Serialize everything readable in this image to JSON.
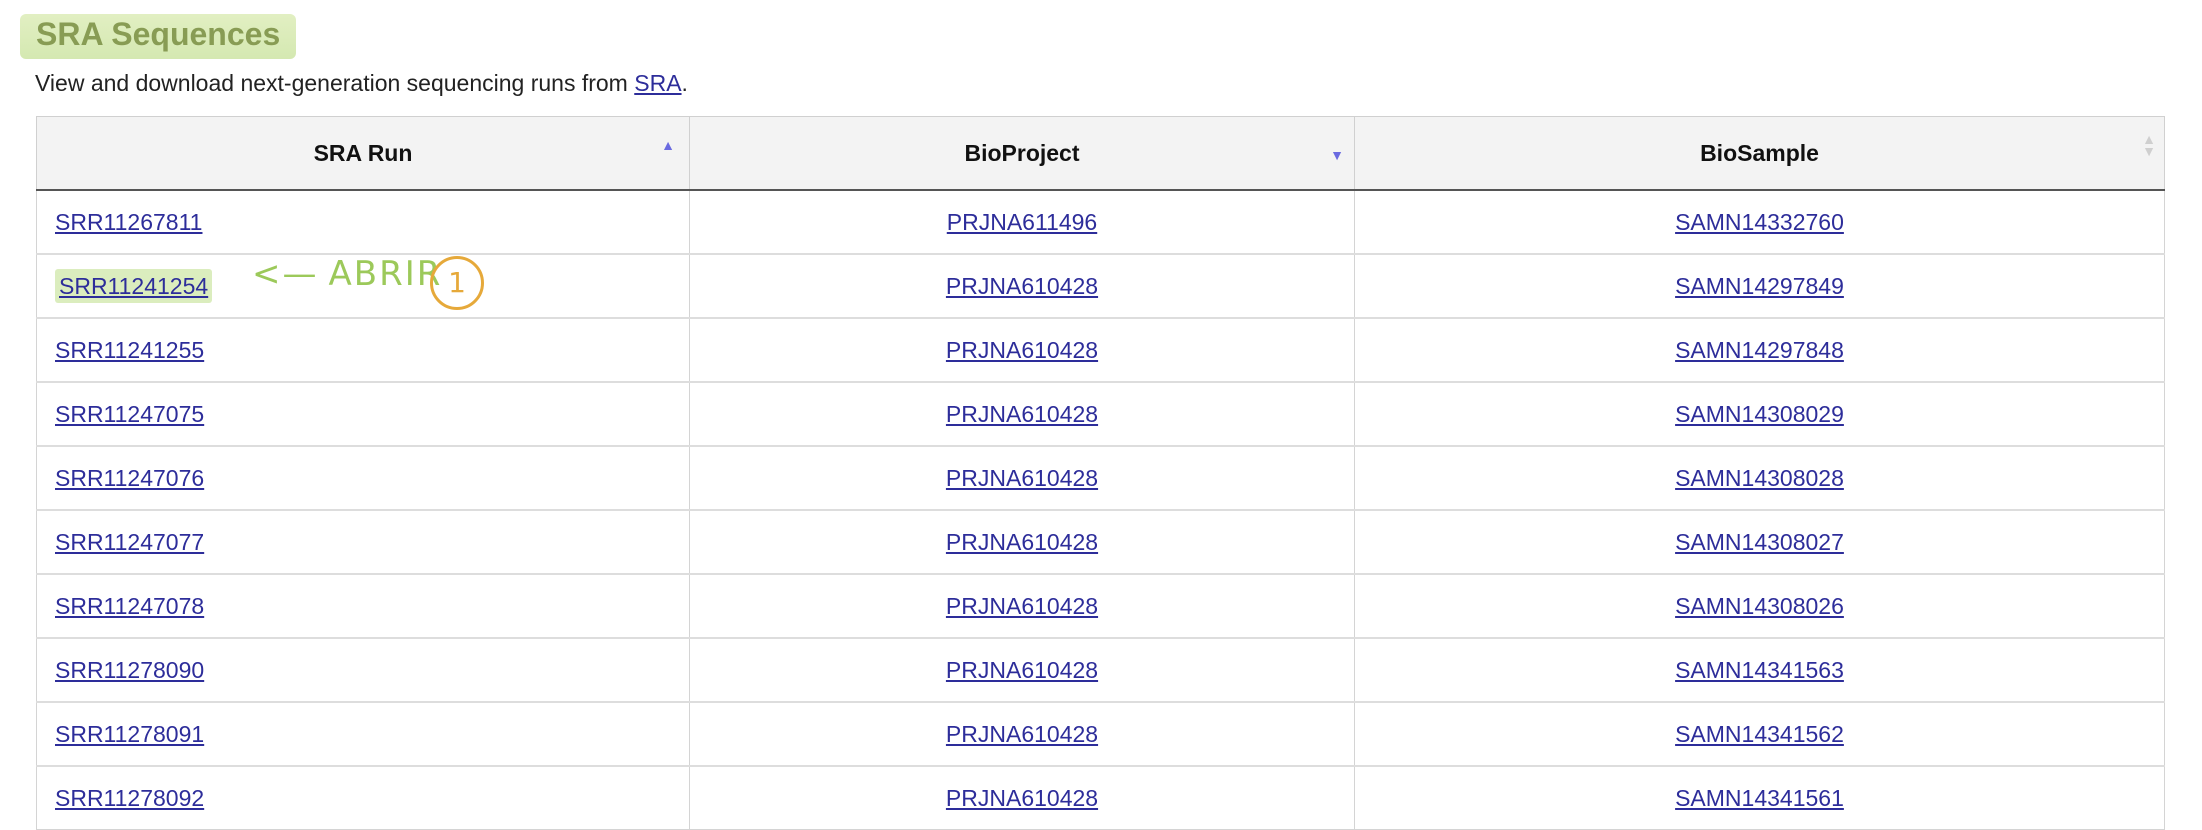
{
  "section": {
    "title": "SRA Sequences",
    "description_prefix": "View and download next-generation sequencing runs from ",
    "description_link": "SRA",
    "description_suffix": "."
  },
  "table": {
    "headers": [
      "SRA Run",
      "BioProject",
      "BioSample"
    ],
    "rows": [
      {
        "run": "SRR11267811",
        "project": "PRJNA611496",
        "sample": "SAMN14332760"
      },
      {
        "run": "SRR11241254",
        "project": "PRJNA610428",
        "sample": "SAMN14297849"
      },
      {
        "run": "SRR11241255",
        "project": "PRJNA610428",
        "sample": "SAMN14297848"
      },
      {
        "run": "SRR11247075",
        "project": "PRJNA610428",
        "sample": "SAMN14308029"
      },
      {
        "run": "SRR11247076",
        "project": "PRJNA610428",
        "sample": "SAMN14308028"
      },
      {
        "run": "SRR11247077",
        "project": "PRJNA610428",
        "sample": "SAMN14308027"
      },
      {
        "run": "SRR11247078",
        "project": "PRJNA610428",
        "sample": "SAMN14308026"
      },
      {
        "run": "SRR11278090",
        "project": "PRJNA610428",
        "sample": "SAMN14341563"
      },
      {
        "run": "SRR11278091",
        "project": "PRJNA610428",
        "sample": "SAMN14341562"
      },
      {
        "run": "SRR11278092",
        "project": "PRJNA610428",
        "sample": "SAMN14341561"
      }
    ]
  },
  "annotation": {
    "arrow": "<—",
    "text": "ABRIR",
    "step": "1"
  },
  "icons": {
    "sort_asc": "sort-ascending-icon",
    "sort_desc": "sort-descending-icon",
    "sort_both": "sort-unsorted-icon"
  },
  "colors": {
    "title_text": "#889c54",
    "link": "#2d2d9a",
    "highlight": "#afd76e",
    "annotation": "#9cc95a",
    "step_circle": "#e6a93a"
  }
}
